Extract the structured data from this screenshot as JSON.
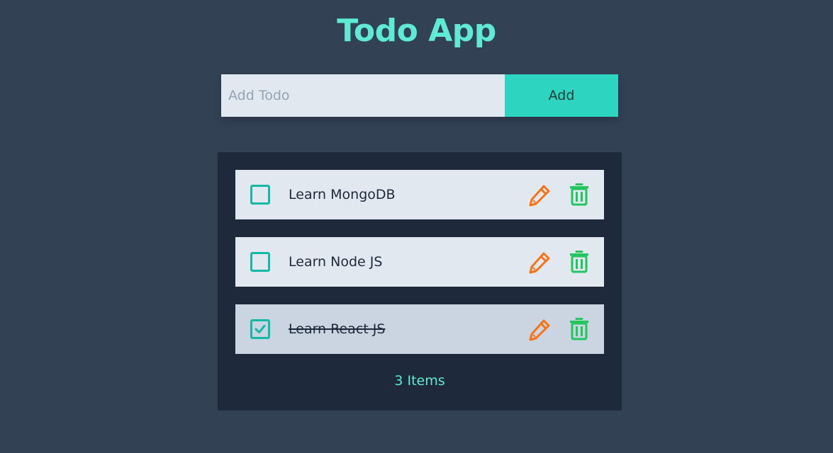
{
  "header": {
    "title": "Todo App"
  },
  "form": {
    "placeholder": "Add Todo",
    "value": "",
    "add_label": "Add"
  },
  "todos": [
    {
      "text": "Learn MongoDB",
      "done": false
    },
    {
      "text": "Learn Node JS",
      "done": false
    },
    {
      "text": "Learn React JS",
      "done": true
    }
  ],
  "footer": {
    "count_label": "3 Items"
  },
  "icons": {
    "checkbox": "checkbox-icon",
    "check": "check-icon",
    "edit": "pencil-icon",
    "delete": "trash-icon"
  },
  "colors": {
    "background": "#334155",
    "panel": "#1e293b",
    "accent": "#2dd4bf",
    "title": "#5eead4",
    "edit": "#f97316",
    "delete": "#22c55e",
    "checkbox": "#14b8a6"
  }
}
